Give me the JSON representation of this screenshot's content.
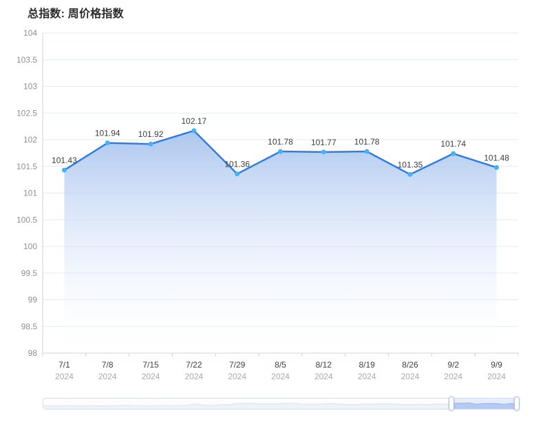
{
  "chart_data": {
    "type": "area",
    "title": "总指数: 周价格指数",
    "categories": [
      "7/1",
      "7/8",
      "7/15",
      "7/22",
      "7/29",
      "8/5",
      "8/12",
      "8/19",
      "8/26",
      "9/2",
      "9/9"
    ],
    "year": "2024",
    "values": [
      101.43,
      101.94,
      101.92,
      102.17,
      101.36,
      101.78,
      101.77,
      101.78,
      101.35,
      101.74,
      101.48
    ],
    "ylim": [
      98,
      104
    ],
    "ytick_step": 0.5,
    "grid": true,
    "legend_position": "none",
    "colors": {
      "line": "#2e7de4",
      "marker": "#49b0f2",
      "area_top": "#a8c3ee",
      "area_bottom": "#ffffff",
      "grid": "#e3e9f3",
      "axis": "#ccd2dd",
      "y_tick_label": "#8f8f8f",
      "x_date_label": "#3f3f3f",
      "x_year_label": "#a8a8a8",
      "value_label": "#3d3d3d",
      "title": "#2b2b2b"
    }
  },
  "slider": {
    "window_start_pct": 86,
    "window_end_pct": 100,
    "preview": [
      0.26,
      0.24,
      0.22,
      0.26,
      0.28,
      0.25,
      0.23,
      0.26,
      0.24,
      0.22,
      0.25,
      0.27,
      0.3,
      0.27,
      0.25,
      0.23,
      0.26,
      0.29,
      0.27,
      0.25,
      0.27,
      0.32,
      0.52,
      0.36,
      0.3,
      0.34,
      0.44,
      0.4,
      0.55,
      0.58,
      0.62,
      0.57,
      0.52,
      0.56,
      0.5,
      0.6,
      0.64,
      0.55,
      0.45,
      0.5,
      0.44,
      0.52,
      0.58,
      0.5,
      0.46,
      0.42,
      0.46,
      0.52,
      0.48,
      0.55,
      0.52,
      0.5,
      0.46,
      0.42,
      0.44,
      0.48,
      0.45,
      0.5,
      0.47,
      0.49,
      0.63,
      0.62,
      0.68,
      0.46,
      0.58,
      0.57,
      0.58,
      0.46,
      0.57,
      0.5
    ],
    "colors": {
      "track_border": "#d8ddeb",
      "track_bg": "#fdfdff",
      "spark_stroke": "#dbe1ee",
      "spark_fill": "#eef2f9",
      "window_spark_stroke": "#93b4ea",
      "window_spark_fill": "#bcd0f2",
      "window_fill": "rgba(150,182,240,0.22)",
      "handle_border": "#b6bfd2"
    }
  }
}
